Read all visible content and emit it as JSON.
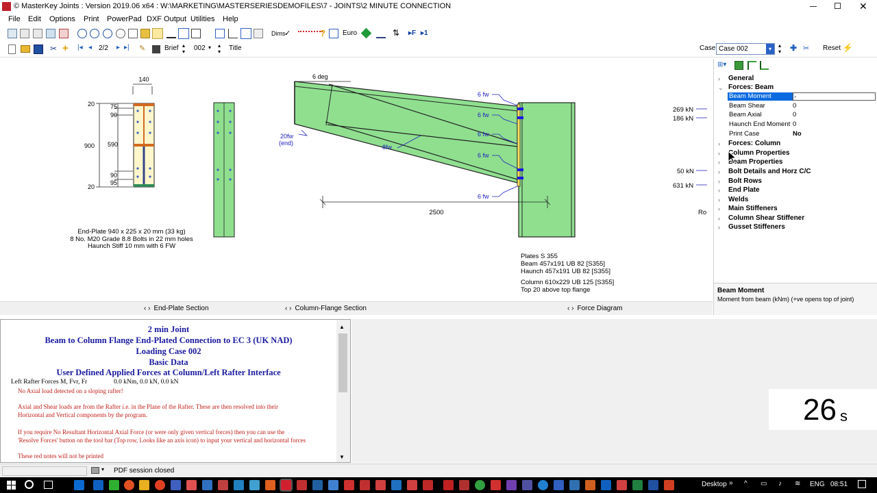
{
  "window": {
    "title": "© MasterKey Joints : Version 2019.06 x64 : W:\\MARKETING\\MASTERSERIESDEMOFILES\\7 - JOINTS\\2 MINUTE CONNECTION",
    "controls": [
      "minimize-icon",
      "restore-icon",
      "close-icon"
    ]
  },
  "menu": [
    "File",
    "Edit",
    "Options",
    "Print",
    "PowerPad",
    "DXF Output",
    "Utilities",
    "Help"
  ],
  "toolbar1": {
    "dims_label": "Dims",
    "euro_label": "Euro",
    "f_label": "F",
    "one_label": "1"
  },
  "toolbar2": {
    "page": "2/2",
    "brief_label": "Brief",
    "case_num": "002",
    "title_label": "Title",
    "case_label": "Case",
    "case_value": "Case 002",
    "reset_label": "Reset"
  },
  "drawing": {
    "endplate": {
      "dim_140": "140",
      "dim_20_top": "20",
      "dim_75": "75",
      "dim_90_top": "90",
      "dim_900": "900",
      "dim_590": "590",
      "dim_90_bot": "90",
      "dim_20_bot": "20",
      "dim_95": "95",
      "caption1": "End-Plate 940 x 225 x 20 mm (33 kg)",
      "caption2": "8 No. M20 Grade 8.8 Bolts in 22 mm holes",
      "caption3": "Haunch Stiff 10 mm with 6 FW"
    },
    "elevation": {
      "angle": "6 deg",
      "weld_end": "20fw",
      "weld_end2": "(end)",
      "weld_8": "8fw",
      "weld_6a": "6 fw",
      "weld_6b": "6 fw",
      "weld_6c": "6 fw",
      "weld_6d": "6 fw",
      "weld_6e": "6 fw",
      "span": "2500",
      "note1": "Plates S 355",
      "note2": "Beam 457x191 UB 82 [S355]",
      "note3": "Haunch 457x191 UB 82 [S355]",
      "note4": "Column 610x229 UB 125 [S355]",
      "note5": "Top 20 above top flange"
    },
    "forces": {
      "f1": "269 kN",
      "f2": "186 kN",
      "f3": "50 kN",
      "f4": "631 kN",
      "row_label": "Ro"
    }
  },
  "tabs": [
    "End-Plate Section",
    "Column-Flange Section",
    "Force Diagram"
  ],
  "properties": {
    "categories": [
      "General",
      "Forces: Beam",
      "Forces: Column",
      "Column Properties",
      "Beam Properties",
      "Bolt Details and Horz C/C",
      "Bolt Rows",
      "End Plate",
      "Welds",
      "Main Stiffeners",
      "Column Shear Stiffener",
      "Gusset Stiffeners"
    ],
    "beam_rows": [
      {
        "label": "Beam Moment",
        "value": "-"
      },
      {
        "label": "Beam Shear",
        "value": "0"
      },
      {
        "label": "Beam Axial",
        "value": "0"
      },
      {
        "label": "Haunch End Moment",
        "value": "0"
      },
      {
        "label": "Print Case",
        "value": "No"
      }
    ],
    "desc_title": "Beam Moment",
    "desc_text": "Moment from beam (kNm) (+ve opens top of joint)"
  },
  "report": {
    "h1": "2 min Joint",
    "h2": "Beam to Column Flange End-Plated Connection to EC 3 (UK NAD)",
    "h3": "Loading Case 002",
    "h4": "Basic Data",
    "h5": "User Defined Applied Forces at Column/Left Rafter Interface",
    "forces_label": "Left Rafter Forces M, Fvr, Fr",
    "forces_value": "0.0 kNm, 0.0 kN, 0.0 kN",
    "n1": "No Axial load detected on a sloping rafter!",
    "n2": "Axial and Shear loads are from the Rafter i.e. in the Plane of the Rafter. These are then resolved into their",
    "n3": "Horizontal and Vertical components by the program.",
    "n4": "If you require No Resultant Horizontal Axial Force (or were only given vertical forces) then you can use the",
    "n5": "'Resolve Forces' button on the tool bar (Top row, Looks like an axis icon) to input your vertical and horizontal forces",
    "n6": "These red notes will not be printed"
  },
  "timer": {
    "value": "26",
    "unit": "s"
  },
  "status": {
    "text": "PDF session closed"
  },
  "taskbar": {
    "desktop": "Desktop",
    "lang": "ENG",
    "time": "08:51"
  },
  "colors": {
    "steel_fill": "#8fdf8f",
    "steel_stroke": "#1a1a1a",
    "endplate_fill": "#fff6cc",
    "bolt": "#1a1adf",
    "weld_label": "#2020c0",
    "report_heading": "#1a1aa0",
    "report_note": "#c0201b",
    "selection": "#0a6ae0"
  }
}
